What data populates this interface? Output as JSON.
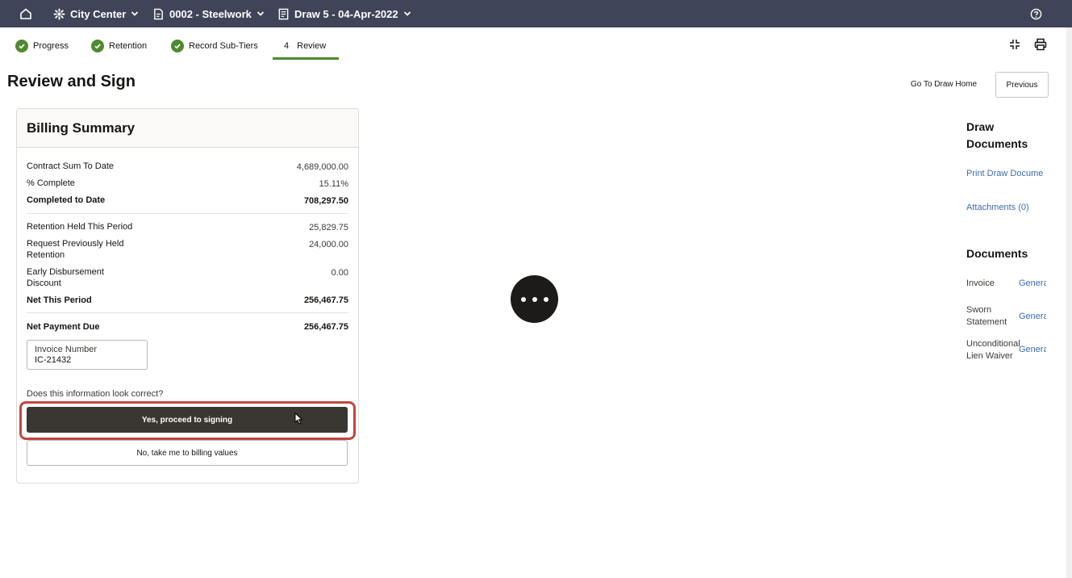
{
  "topbar": {
    "project": "City Center",
    "commitment": "0002 - Steelwork",
    "draw": "Draw 5 - 04-Apr-2022"
  },
  "steps": [
    {
      "label": "Progress",
      "state": "complete"
    },
    {
      "label": "Retention",
      "state": "complete"
    },
    {
      "label": "Record Sub-Tiers",
      "state": "complete"
    },
    {
      "number": "4",
      "label": "Review",
      "state": "current"
    }
  ],
  "page": {
    "title": "Review and Sign",
    "go_to_draw_home": "Go To Draw Home",
    "previous": "Previous"
  },
  "billing_summary": {
    "title": "Billing Summary",
    "rows": [
      {
        "label": "Contract Sum To Date",
        "value": "4,689,000.00"
      },
      {
        "label": "% Complete",
        "value": "15.11%"
      },
      {
        "label": "Completed to Date",
        "value": "708,297.50"
      },
      {
        "label": "Retention Held This Period",
        "value": "25,829.75"
      },
      {
        "label": "Request Previously Held Retention",
        "value": "24,000.00"
      },
      {
        "label": "Early Disbursement Discount",
        "value": "0.00"
      },
      {
        "label": "Net This Period",
        "value": "256,467.75"
      },
      {
        "label": "Net Payment Due",
        "value": "256,467.75"
      }
    ],
    "invoice_number_label": "Invoice Number",
    "invoice_number_value": "IC-21432",
    "question": "Does this information look correct?",
    "yes_button": "Yes, proceed to signing",
    "no_button": "No, take me to billing values"
  },
  "right_panel": {
    "draw_documents_title": "Draw Documents",
    "print_link": "Print Draw Docume",
    "attachments_link": "Attachments (0)",
    "documents_title": "Documents",
    "documents": [
      {
        "label": "Invoice",
        "action": "Genera"
      },
      {
        "label": "Sworn Statement",
        "action": "Genera"
      },
      {
        "label": "Unconditional Lien Waiver",
        "action": "Genera"
      }
    ]
  },
  "colors": {
    "topbar": "#3f4459",
    "step_complete": "#4f8a2f",
    "primary_button": "#3a3632",
    "highlight": "#c0483e",
    "link": "#3d6ca8"
  }
}
